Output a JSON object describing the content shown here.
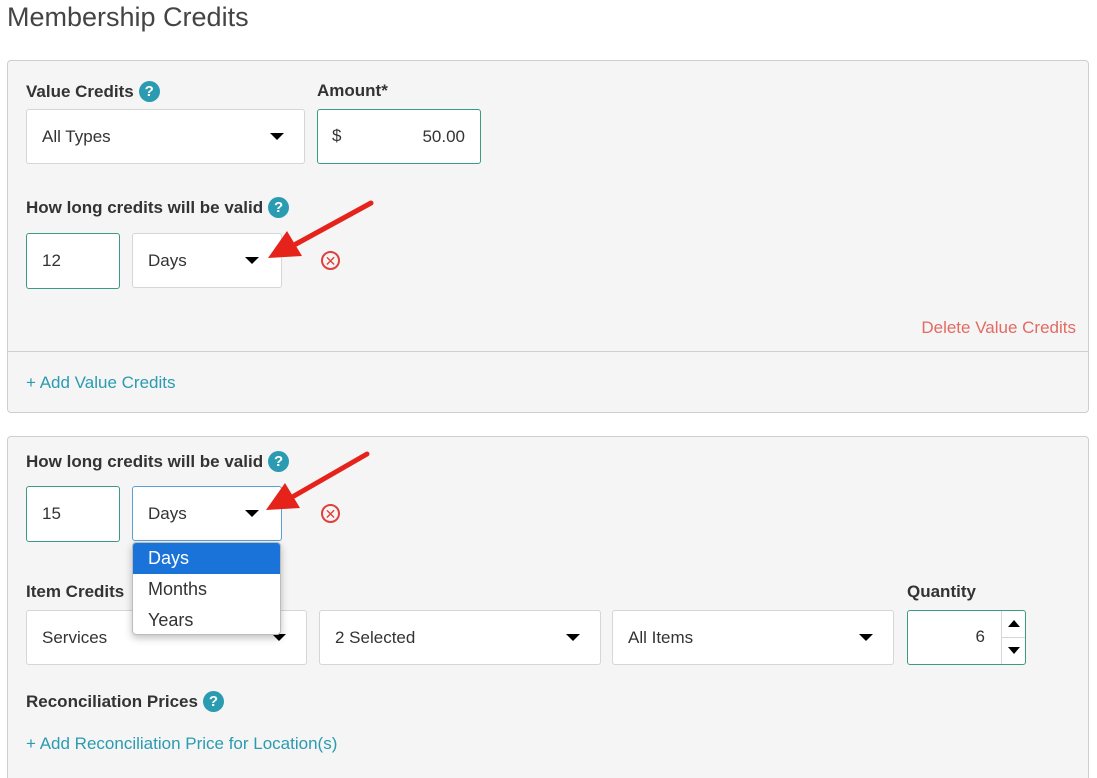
{
  "page": {
    "title": "Membership Credits"
  },
  "value_credits": {
    "label": "Value Credits",
    "type_value": "All Types",
    "amount_label": "Amount*",
    "currency_symbol": "$",
    "amount_value": "50.00",
    "validity_label": "How long credits will be valid",
    "validity_number": "12",
    "validity_unit": "Days",
    "delete_label": "Delete Value Credits",
    "add_label": "+ Add Value Credits"
  },
  "item_credits": {
    "validity_label": "How long credits will be valid",
    "validity_number": "15",
    "validity_unit": "Days",
    "unit_options": [
      "Days",
      "Months",
      "Years"
    ],
    "selected_option": "Days",
    "label": "Item Credits",
    "category_value": "Services",
    "selection_value": "2 Selected",
    "items_value": "All Items",
    "quantity_label": "Quantity",
    "quantity_value": "6",
    "reconciliation_label": "Reconciliation Prices",
    "add_reconciliation_label": "+ Add Reconciliation Price for Location(s)"
  },
  "icons": {
    "help": "question-circle-icon",
    "remove": "x-circle-icon",
    "caret": "caret-down-icon"
  },
  "colors": {
    "accent": "#2a9bb1",
    "danger": "#e26b62",
    "focus_border": "#3c9a84",
    "menu_selected": "#1a73d9",
    "annotation_arrow": "#e5231b"
  }
}
